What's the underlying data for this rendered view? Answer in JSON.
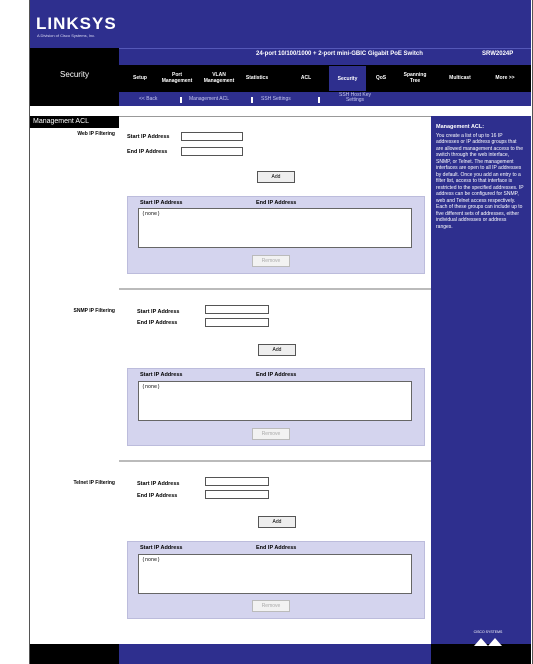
{
  "brand": {
    "logo": "LINKSYS",
    "tagline": "A Division of Cisco Systems, Inc."
  },
  "product_title": "24-port 10/100/1000 + 2-port mini-GBIC Gigabit PoE Switch",
  "model": "SRW2024P",
  "section": "Security",
  "nav": [
    {
      "label": "Setup"
    },
    {
      "label": "Port Management"
    },
    {
      "label": "VLAN Management"
    },
    {
      "label": "Statistics"
    },
    {
      "label": "ACL"
    },
    {
      "label": "Security"
    },
    {
      "label": "QoS"
    },
    {
      "label": "Spanning Tree"
    },
    {
      "label": "Multicast"
    },
    {
      "label": "More >>"
    }
  ],
  "subnav": [
    {
      "label": "<< Back"
    },
    {
      "label": "Management ACL"
    },
    {
      "label": "SSH Settings"
    },
    {
      "label": "SSH Host Key Settings"
    }
  ],
  "left_heading": "Management ACL",
  "web_section": {
    "label": "Web IP Filtering",
    "start_label": "Start IP Address",
    "end_label": "End IP Address",
    "start_value": "",
    "end_value": "",
    "add_label": "Add",
    "col_start": "Start IP Address",
    "col_end": "End IP Address",
    "list_item": "(none)",
    "remove_label": "Remove"
  },
  "snmp_section": {
    "label": "SNMP IP Filtering",
    "start_label": "Start IP Address",
    "end_label": "End IP Address",
    "start_value": "",
    "end_value": "",
    "add_label": "Add",
    "col_start": "Start IP Address",
    "col_end": "End IP Address",
    "list_item": "(none)",
    "remove_label": "Remove"
  },
  "telnet_section": {
    "label": "Telnet IP Filtering",
    "start_label": "Start IP Address",
    "end_label": "End IP Address",
    "start_value": "",
    "end_value": "",
    "add_label": "Add",
    "col_start": "Start IP Address",
    "col_end": "End IP Address",
    "list_item": "(none)",
    "remove_label": "Remove"
  },
  "help": {
    "title": "Management ACL:",
    "body": "You create a list of up to 16 IP addresses or IP address groups that are allowed management access to the switch through the web interface, SNMP, or Telnet. The management interfaces are open to all IP addresses by default. Once you add an entry to a filter list, access to that interface is restricted to the specified addresses. IP address can be configured for SNMP, web and Telnet access respectively. Each of these groups can include up to five different sets of addresses, either individual addresses or address ranges."
  },
  "footer": {
    "cisco": "CISCO SYSTEMS"
  },
  "colors": {
    "brand_blue": "#2e2f8e",
    "panel": "#d4d4ee",
    "black": "#000000"
  }
}
